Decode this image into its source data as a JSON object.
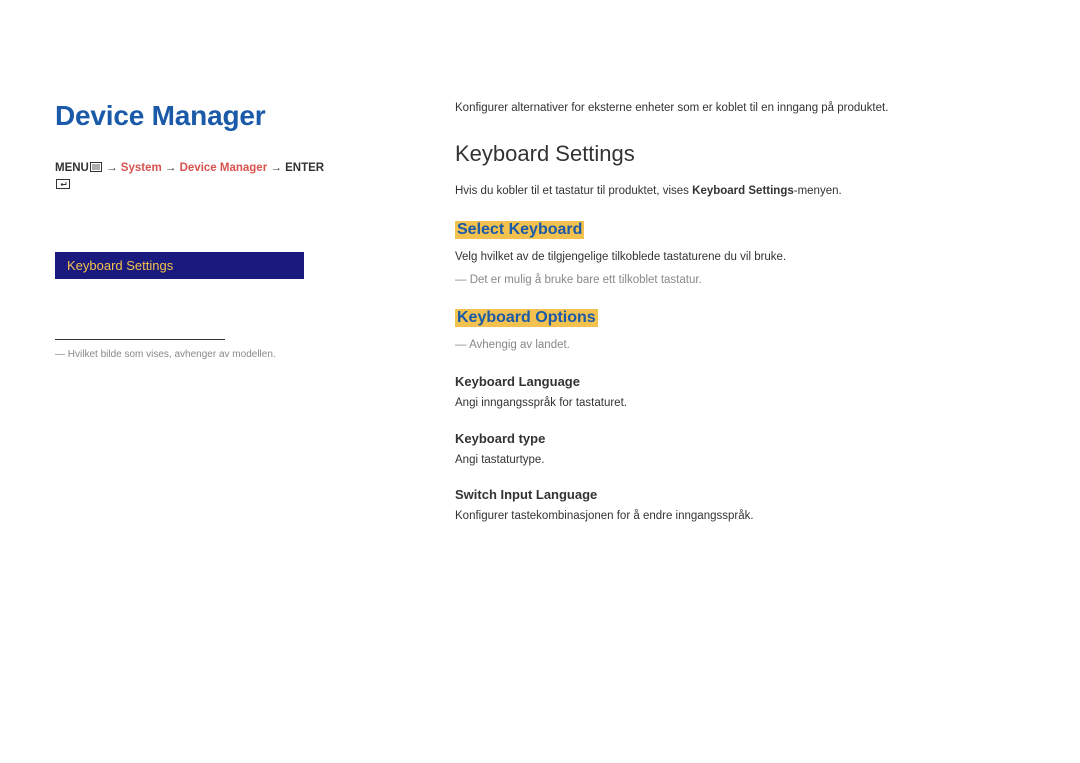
{
  "left": {
    "title": "Device Manager",
    "breadcrumb": {
      "menu_label": "MENU",
      "arrow": " → ",
      "system": "System",
      "device_manager": "Device Manager",
      "enter_label": "ENTER"
    },
    "menu_item": "Keyboard Settings",
    "footnote": "Hvilket bilde som vises, avhenger av modellen."
  },
  "right": {
    "intro": "Konfigurer alternativer for eksterne enheter som er koblet til en inngang på produktet.",
    "section_title": "Keyboard Settings",
    "section_desc_prefix": "Hvis du kobler til et tastatur til produktet, vises ",
    "section_desc_bold": "Keyboard Settings",
    "section_desc_suffix": "-menyen.",
    "select_keyboard": {
      "heading": "Select Keyboard",
      "body": "Velg hvilket av de tilgjengelige tilkoblede tastaturene du vil bruke.",
      "note": "Det er mulig å bruke bare ett tilkoblet tastatur."
    },
    "keyboard_options": {
      "heading": "Keyboard Options",
      "note": "Avhengig av landet.",
      "language": {
        "title": "Keyboard Language",
        "body": "Angi inngangsspråk for tastaturet."
      },
      "type": {
        "title": "Keyboard type",
        "body": "Angi tastaturtype."
      },
      "switch": {
        "title": "Switch Input Language",
        "body": "Konfigurer tastekombinasjonen for å endre inngangsspråk."
      }
    }
  }
}
